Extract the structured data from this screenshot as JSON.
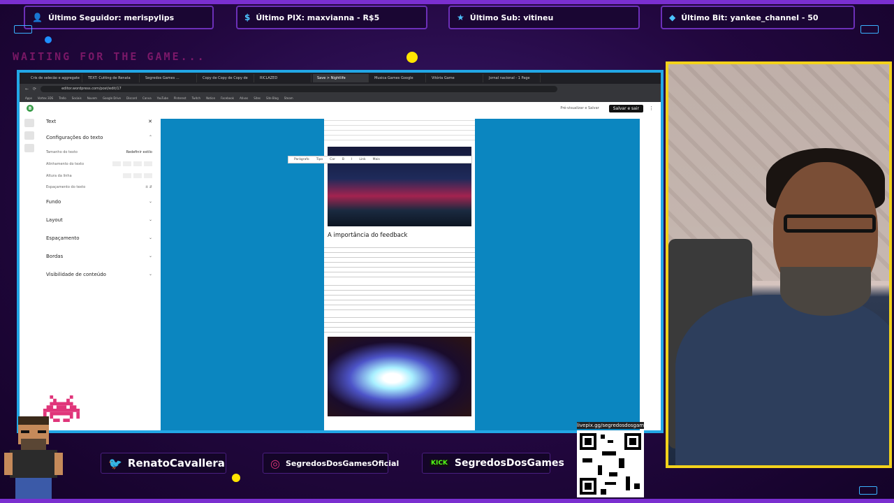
{
  "overlay": {
    "alerts": [
      {
        "icon": "user-icon",
        "text": "Último Seguidor: merispylips"
      },
      {
        "icon": "dollar-icon",
        "text": "Último PIX: maxvianna - R$5"
      },
      {
        "icon": "star-icon",
        "text": "Último Sub: vitineu"
      },
      {
        "icon": "diamond-icon",
        "text": "Último Bit: yankee_channel - 50"
      }
    ],
    "waiting_text": "WAITING FOR THE GAME...",
    "socials": [
      {
        "icon": "twitter-icon",
        "text": "RenatoCavallera"
      },
      {
        "icon": "instagram-icon",
        "text": "SegredosDosGamesOficial"
      },
      {
        "icon": "kick-icon",
        "text": "SegredosDosGames"
      }
    ],
    "qr_label": "livepix.gg/segredosdosgames",
    "colors": {
      "accent": "#22a7e6",
      "cam_border": "#f2d21b",
      "brand_purple": "#7a2fd0"
    }
  },
  "browser": {
    "url": "editor.wordpress.com/post/edit/17",
    "tabs": [
      "Cris de selecão e aggregate",
      "TEXT: Cutting de Renata",
      "Segredos Games ...",
      "Copy de Copy de Copy de",
      "RICLAZED",
      "Save > Nightlife",
      "Musica Games Google",
      "Vitória Game",
      "Jornal nacional - 1 Page"
    ],
    "bookmarks": [
      "Apps",
      "Vortex 3DS",
      "Trello",
      "Sociais",
      "Nuvem",
      "Google Drive",
      "Discord",
      "Canva",
      "YouTube",
      "Pinterest",
      "Twitch",
      "Notion",
      "Facebook",
      "Ativos",
      "Sites",
      "Site Blog",
      "Steam"
    ],
    "wp": {
      "save_label": "Salvar e sair",
      "draft_label": "Pré-visualizar e Salvar",
      "block_title": "Text",
      "sidebar_sections": [
        "Configurações do texto",
        "Fundo",
        "Layout",
        "Espaçamento",
        "Bordas",
        "Visibilidade de conteúdo"
      ],
      "rows": [
        "Tamanho do texto",
        "Alinhamento do texto",
        "Altura da linha",
        "Espaçamento do texto"
      ],
      "reset_label": "Redefinir estilo",
      "heading": "A importância do feedback",
      "toolbar_items": [
        "Parágrafo",
        "Tipo",
        "Cor",
        "B",
        "I",
        "Link",
        "Mais"
      ]
    }
  }
}
